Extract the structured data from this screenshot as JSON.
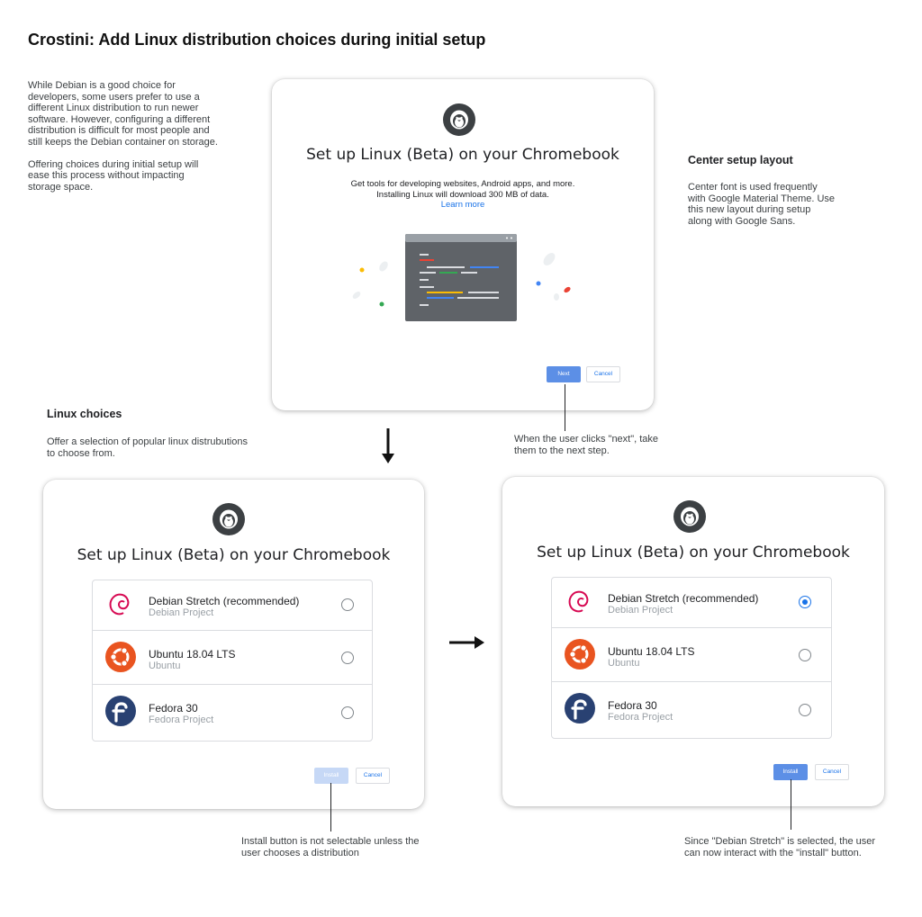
{
  "page_title": "Crostini: Add Linux distribution choices during initial setup",
  "intro_note": "While Debian is a good choice for\ndevelopers, some users prefer to use a\ndifferent Linux distribution to run newer\nsoftware. However, configuring a different\ndistribution is difficult for most people and\nstill keeps the Debian container on storage.\n\nOffering choices during initial setup will\nease this process without impacting\nstorage space.",
  "center_layout": {
    "title": "Center setup layout",
    "body": "Center font is used frequently\nwith Google Material Theme. Use\nthis new layout during setup\nalong with Google Sans."
  },
  "linux_choices": {
    "title": "Linux choices",
    "body": "Offer a selection of popular linux distrubutions\nto choose from."
  },
  "next_note": "When the user clicks \"next\", take\nthem to the next step.",
  "install_note": "Install button is not selectable unless the\nuser chooses a distribution",
  "selected_note": "Since \"Debian Stretch\" is selected, the user\ncan now interact with the \"install\" button.",
  "dialog": {
    "title": "Set up Linux (Beta) on your Chromebook",
    "description_1": "Get tools for developing websites, Android apps, and more.",
    "description_2": "Installing Linux will download 300 MB of data.",
    "learn_more": "Learn more",
    "next_label": "Next",
    "cancel_label": "Cancel",
    "install_label": "Install"
  },
  "distros": [
    {
      "name": "Debian Stretch (recommended)",
      "vendor": "Debian Project",
      "icon": "debian-logo-icon"
    },
    {
      "name": "Ubuntu 18.04 LTS",
      "vendor": "Ubuntu",
      "icon": "ubuntu-logo-icon"
    },
    {
      "name": "Fedora 30",
      "vendor": "Fedora Project",
      "icon": "fedora-logo-icon"
    }
  ],
  "selection": {
    "step2_selected": null,
    "step3_selected": "Debian Stretch (recommended)"
  },
  "colors": {
    "accent": "#1a73e8",
    "button_blue": "#5c8fe6",
    "button_disabled": "#c6d8f6",
    "terminal": "#5f6368"
  }
}
